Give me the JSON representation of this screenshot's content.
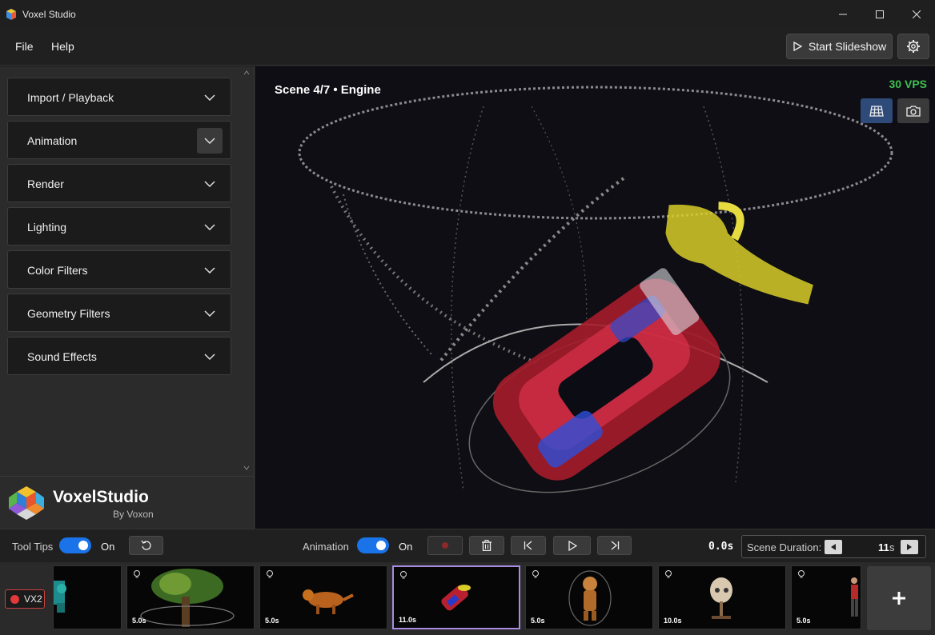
{
  "window": {
    "title": "Voxel Studio"
  },
  "menu": {
    "file": "File",
    "help": "Help"
  },
  "toolbar": {
    "slideshow_label": "Start Slideshow"
  },
  "sidebar": {
    "sections": [
      {
        "label": "Import / Playback"
      },
      {
        "label": "Animation"
      },
      {
        "label": "Render"
      },
      {
        "label": "Lighting"
      },
      {
        "label": "Color Filters"
      },
      {
        "label": "Geometry Filters"
      },
      {
        "label": "Sound Effects"
      }
    ],
    "logo_name": "VoxelStudio",
    "logo_by": "By Voxon"
  },
  "viewport": {
    "scene_label": "Scene 4/7  •  Engine",
    "vps": "30 VPS"
  },
  "controls": {
    "tooltips_label": "Tool Tips",
    "tooltips_state": "On",
    "animation_label": "Animation",
    "animation_state": "On",
    "time": "0.0s",
    "duration_label": "Scene Duration:",
    "duration_value": "11",
    "duration_unit": "s"
  },
  "filmstrip": {
    "device_label": "VX2",
    "thumbs": [
      {
        "duration": ""
      },
      {
        "duration": "5.0s"
      },
      {
        "duration": "5.0s"
      },
      {
        "duration": "11.0s"
      },
      {
        "duration": "5.0s"
      },
      {
        "duration": "10.0s"
      },
      {
        "duration": "5.0s"
      }
    ]
  },
  "colors": {
    "accent": "#1a73e8",
    "vps": "#3fbf4f",
    "selected": "#a88be0",
    "record": "#e23a3a"
  }
}
